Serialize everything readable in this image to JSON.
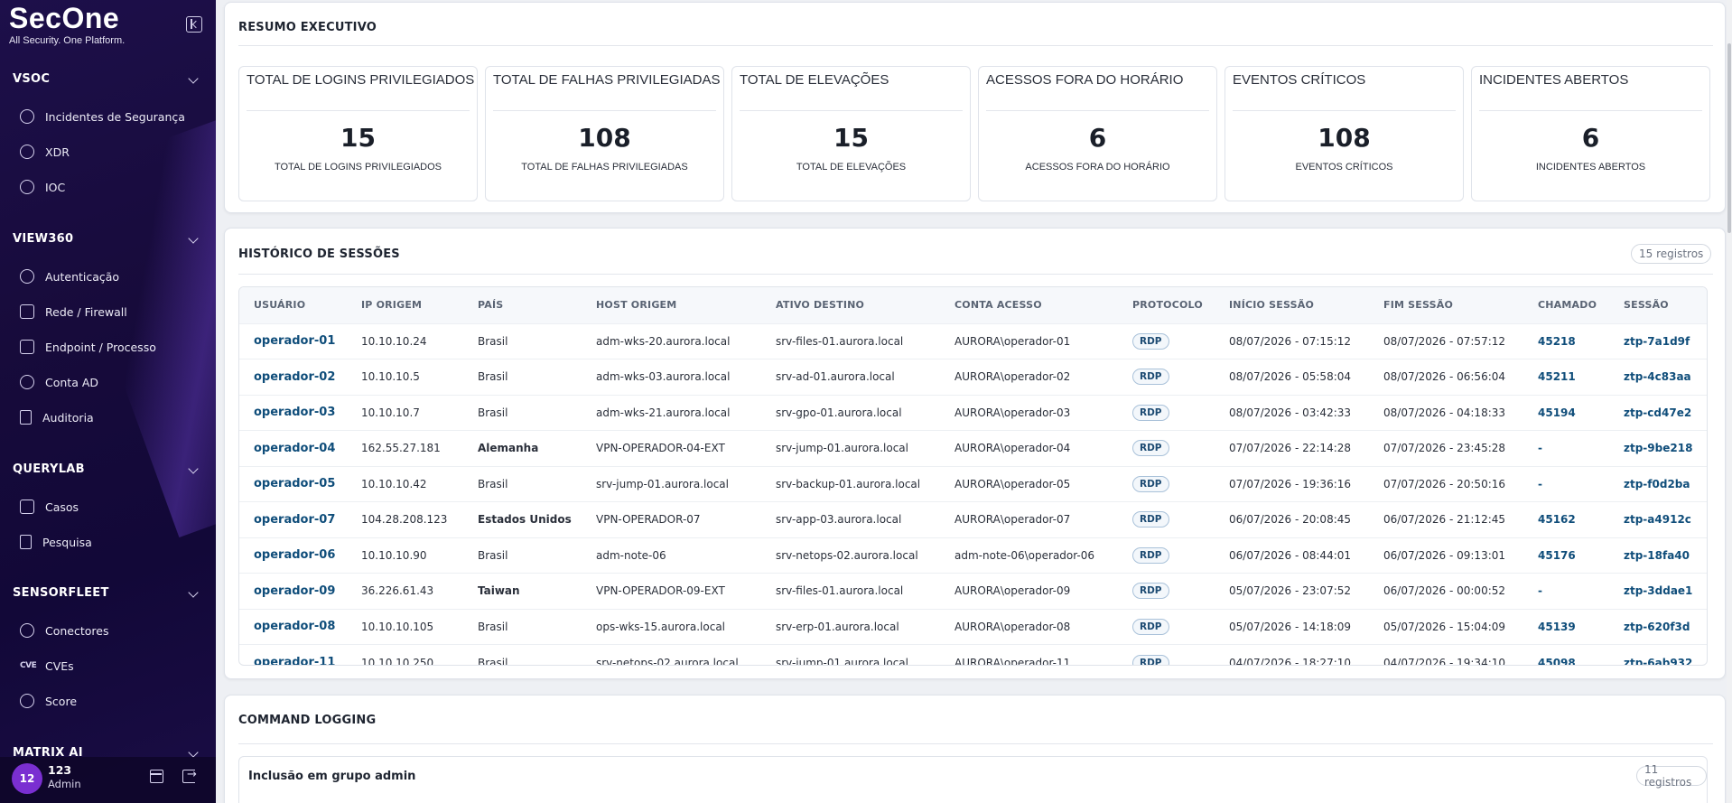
{
  "brand": {
    "name": "SecOne",
    "tagline": "All Security. One Platform."
  },
  "sidebar": {
    "sections": [
      {
        "label": "VSOC",
        "items": [
          {
            "label": "Incidentes de Segurança",
            "icon": "shield-search-icon"
          },
          {
            "label": "XDR",
            "icon": "radar-icon"
          },
          {
            "label": "IOC",
            "icon": "target-icon"
          }
        ]
      },
      {
        "label": "VIEW360",
        "items": [
          {
            "label": "Autenticação",
            "icon": "key-icon"
          },
          {
            "label": "Rede / Firewall",
            "icon": "network-icon"
          },
          {
            "label": "Endpoint / Processo",
            "icon": "cpu-icon"
          },
          {
            "label": "Conta AD",
            "icon": "user-icon"
          },
          {
            "label": "Auditoria",
            "icon": "audit-doc-icon"
          }
        ]
      },
      {
        "label": "QUERYLAB",
        "items": [
          {
            "label": "Casos",
            "icon": "briefcase-icon"
          },
          {
            "label": "Pesquisa",
            "icon": "search-doc-icon"
          }
        ]
      },
      {
        "label": "SENSORFLEET",
        "items": [
          {
            "label": "Conectores",
            "icon": "gear-icon"
          },
          {
            "label": "CVEs",
            "icon": "cve-icon"
          },
          {
            "label": "Score",
            "icon": "gauge-icon"
          }
        ]
      },
      {
        "label": "MATRIX AI",
        "items": []
      }
    ],
    "user": {
      "avatar": "12",
      "name": "123",
      "role": "Admin"
    },
    "cve_icon_text": "CVE"
  },
  "summary": {
    "title": "RESUMO EXECUTIVO",
    "kpis": [
      {
        "title": "TOTAL DE LOGINS PRIVILEGIADOS",
        "value": "15",
        "sub": "TOTAL DE LOGINS PRIVILEGIADOS"
      },
      {
        "title": "TOTAL DE FALHAS PRIVILEGIADAS",
        "value": "108",
        "sub": "TOTAL DE FALHAS PRIVILEGIADAS"
      },
      {
        "title": "TOTAL DE ELEVAÇÕES",
        "value": "15",
        "sub": "TOTAL DE ELEVAÇÕES"
      },
      {
        "title": "ACESSOS FORA DO HORÁRIO",
        "value": "6",
        "sub": "ACESSOS FORA DO HORÁRIO"
      },
      {
        "title": "EVENTOS CRÍTICOS",
        "value": "108",
        "sub": "EVENTOS CRÍTICOS"
      },
      {
        "title": "INCIDENTES ABERTOS",
        "value": "6",
        "sub": "INCIDENTES ABERTOS"
      }
    ]
  },
  "sessions": {
    "title": "HISTÓRICO DE SESSÕES",
    "count": "15 registros",
    "columns": [
      "USUÁRIO",
      "IP ORIGEM",
      "PAÍS",
      "HOST ORIGEM",
      "ATIVO DESTINO",
      "CONTA ACESSO",
      "PROTOCOLO",
      "INÍCIO SESSÃO",
      "FIM SESSÃO",
      "CHAMADO",
      "SESSÃO"
    ],
    "rows": [
      [
        "operador-01",
        "10.10.10.24",
        "Brasil",
        "adm-wks-20.aurora.local",
        "srv-files-01.aurora.local",
        "AURORA\\operador-01",
        "RDP",
        "08/07/2026 - 07:15:12",
        "08/07/2026 - 07:57:12",
        "45218",
        "ztp-7a1d9f"
      ],
      [
        "operador-02",
        "10.10.10.5",
        "Brasil",
        "adm-wks-03.aurora.local",
        "srv-ad-01.aurora.local",
        "AURORA\\operador-02",
        "RDP",
        "08/07/2026 - 05:58:04",
        "08/07/2026 - 06:56:04",
        "45211",
        "ztp-4c83aa"
      ],
      [
        "operador-03",
        "10.10.10.7",
        "Brasil",
        "adm-wks-21.aurora.local",
        "srv-gpo-01.aurora.local",
        "AURORA\\operador-03",
        "RDP",
        "08/07/2026 - 03:42:33",
        "08/07/2026 - 04:18:33",
        "45194",
        "ztp-cd47e2"
      ],
      [
        "operador-04",
        "162.55.27.181",
        "Alemanha",
        "VPN-OPERADOR-04-EXT",
        "srv-jump-01.aurora.local",
        "AURORA\\operador-04",
        "RDP",
        "07/07/2026 - 22:14:28",
        "07/07/2026 - 23:45:28",
        "-",
        "ztp-9be218"
      ],
      [
        "operador-05",
        "10.10.10.42",
        "Brasil",
        "srv-jump-01.aurora.local",
        "srv-backup-01.aurora.local",
        "AURORA\\operador-05",
        "RDP",
        "07/07/2026 - 19:36:16",
        "07/07/2026 - 20:50:16",
        "-",
        "ztp-f0d2ba"
      ],
      [
        "operador-07",
        "104.28.208.123",
        "Estados Unidos",
        "VPN-OPERADOR-07",
        "srv-app-03.aurora.local",
        "AURORA\\operador-07",
        "RDP",
        "06/07/2026 - 20:08:45",
        "06/07/2026 - 21:12:45",
        "45162",
        "ztp-a4912c"
      ],
      [
        "operador-06",
        "10.10.10.90",
        "Brasil",
        "adm-note-06",
        "srv-netops-02.aurora.local",
        "adm-note-06\\operador-06",
        "RDP",
        "06/07/2026 - 08:44:01",
        "06/07/2026 - 09:13:01",
        "45176",
        "ztp-18fa40"
      ],
      [
        "operador-09",
        "36.226.61.43",
        "Taiwan",
        "VPN-OPERADOR-09-EXT",
        "srv-files-01.aurora.local",
        "AURORA\\operador-09",
        "RDP",
        "05/07/2026 - 23:07:52",
        "06/07/2026 - 00:00:52",
        "-",
        "ztp-3ddae1"
      ],
      [
        "operador-08",
        "10.10.10.105",
        "Brasil",
        "ops-wks-15.aurora.local",
        "srv-erp-01.aurora.local",
        "AURORA\\operador-08",
        "RDP",
        "05/07/2026 - 14:18:09",
        "05/07/2026 - 15:04:09",
        "45139",
        "ztp-620f3d"
      ],
      [
        "operador-11",
        "10.10.10.250",
        "Brasil",
        "srv-netops-02.aurora.local",
        "srv-jump-01.aurora.local",
        "AURORA\\operador-11",
        "RDP",
        "04/07/2026 - 18:27:10",
        "04/07/2026 - 19:34:10",
        "45098",
        "ztp-6ab932"
      ]
    ]
  },
  "command_logging": {
    "title": "COMMAND LOGGING",
    "group_title": "Inclusão em grupo admin",
    "group_count": "11 registros"
  }
}
